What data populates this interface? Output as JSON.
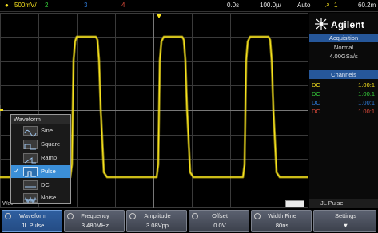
{
  "topbar": {
    "ch1_scale": "500mV/",
    "ch2": "2",
    "ch3": "3",
    "ch4": "4",
    "time_offset": "0.0s",
    "time_scale": "100.0µ/",
    "trigger_mode": "Auto",
    "trigger_source": "1",
    "trigger_level": "60.2m"
  },
  "brand": {
    "logo_text": "Agilent"
  },
  "acquisition": {
    "header": "Acquisition",
    "mode": "Normal",
    "rate": "4.00GSa/s"
  },
  "channels": {
    "header": "Channels",
    "rows": [
      {
        "coupling": "DC",
        "value": "1.00:1",
        "color": "#f6e11e"
      },
      {
        "coupling": "DC",
        "value": "1.00:1",
        "color": "#37d13b"
      },
      {
        "coupling": "DC",
        "value": "1.00:1",
        "color": "#2e7bd8"
      },
      {
        "coupling": "DC",
        "value": "1.00:1",
        "color": "#e04b3b"
      }
    ]
  },
  "waveform_menu": {
    "title": "Waveform",
    "items": [
      {
        "label": "Sine",
        "icon": "sine-icon",
        "selected": false
      },
      {
        "label": "Square",
        "icon": "square-wave-icon",
        "selected": false
      },
      {
        "label": "Ramp",
        "icon": "ramp-icon",
        "selected": false
      },
      {
        "label": "Pulse",
        "icon": "pulse-icon",
        "selected": true
      },
      {
        "label": "DC",
        "icon": "dc-icon",
        "selected": false
      },
      {
        "label": "Noise",
        "icon": "noise-icon",
        "selected": false
      }
    ]
  },
  "bottom_fragment": "Wav",
  "pulse_tag": "JL  Pulse",
  "softkeys": [
    {
      "top": "Waveform",
      "bottom": "JL  Pulse"
    },
    {
      "top": "Frequency",
      "bottom": "3.480MHz"
    },
    {
      "top": "Amplitude",
      "bottom": "3.08Vpp"
    },
    {
      "top": "Offset",
      "bottom": "0.0V"
    },
    {
      "top": "Width Fine",
      "bottom": "80ns"
    },
    {
      "top": "Settings",
      "bottom": "▼"
    }
  ],
  "colors": {
    "ch1": "#f6e11e",
    "ch2": "#37d13b",
    "ch3": "#2e7bd8",
    "ch4": "#e04b3b",
    "menu_selected": "#3b8fd8",
    "panel_header": "#26579a",
    "grid": "#3a3a3a"
  }
}
